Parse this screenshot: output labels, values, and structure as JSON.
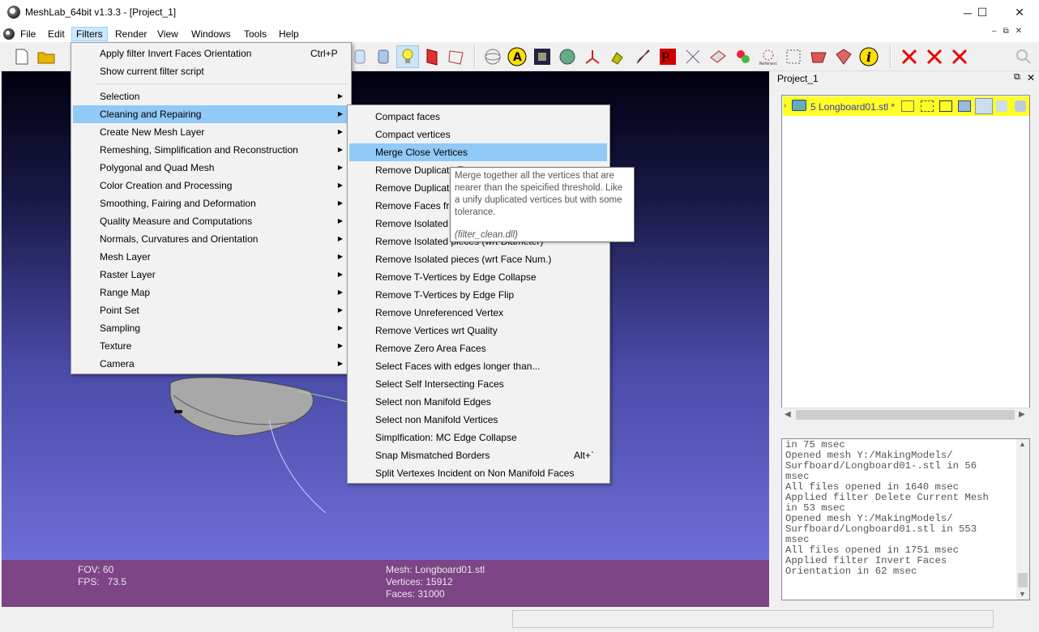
{
  "window": {
    "title": "MeshLab_64bit v1.3.3 - [Project_1]",
    "minimize": "─",
    "maximize": "☐",
    "close": "✕"
  },
  "menubar": {
    "items": [
      "File",
      "Edit",
      "Filters",
      "Render",
      "View",
      "Windows",
      "Tools",
      "Help"
    ],
    "active": "Filters",
    "mdi": [
      "–",
      "⧉",
      "✕"
    ]
  },
  "filters_menu": {
    "apply_label": "Apply filter Invert Faces Orientation",
    "apply_shortcut": "Ctrl+P",
    "show_script": "Show current filter script",
    "items": [
      "Selection",
      "Cleaning and Repairing",
      "Create New Mesh Layer",
      "Remeshing, Simplification and Reconstruction",
      "Polygonal and Quad Mesh",
      "Color Creation and Processing",
      "Smoothing, Fairing and Deformation",
      "Quality Measure and Computations",
      "Normals, Curvatures and Orientation",
      "Mesh Layer",
      "Raster Layer",
      "Range Map",
      "Point Set",
      "Sampling",
      "Texture",
      "Camera"
    ],
    "highlighted": "Cleaning and Repairing"
  },
  "cleaning_submenu": {
    "items": [
      "Compact faces",
      "Compact vertices",
      "Merge Close Vertices",
      "Remove Duplicate F",
      "Remove Duplicate",
      "Remove Faces fro",
      "Remove Isolated",
      "Remove Isolated pieces (wrt Diameter)",
      "Remove Isolated pieces (wrt Face Num.)",
      "Remove T-Vertices by Edge Collapse",
      "Remove T-Vertices by Edge Flip",
      "Remove Unreferenced Vertex",
      "Remove Vertices wrt Quality",
      "Remove Zero Area Faces",
      "Select Faces with edges longer than...",
      "Select Self Intersecting Faces",
      "Select non Manifold Edges",
      "Select non Manifold Vertices",
      "Simplfication: MC Edge Collapse",
      "Snap Mismatched Borders",
      "Split Vertexes Incident on Non Manifold Faces"
    ],
    "highlighted": "Merge Close Vertices",
    "snap_shortcut": "Alt+`"
  },
  "tooltip": {
    "text": "Merge together all the vertices that are nearer than the speicified threshold. Like a unify duplicated vertices but with some tolerance.",
    "plugin": "(filter_clean.dll)"
  },
  "viewport_info": {
    "fov": "FOV: 60",
    "fps": "FPS:   73.5",
    "mesh": "Mesh: Longboard01.stl",
    "vertices": "Vertices: 15912",
    "faces": "Faces: 31000"
  },
  "project_panel": {
    "title": "Project_1",
    "layer": "5  Longboard01.stl *"
  },
  "log": {
    "lines": [
      "in 75 msec",
      "Opened mesh Y:/MakingModels/",
      "Surfboard/Longboard01-.stl in 56",
      "msec",
      "All files opened in 1640 msec",
      "Applied filter Delete Current Mesh",
      "in 53 msec",
      "Opened mesh Y:/MakingModels/",
      "Surfboard/Longboard01.stl in 553",
      "msec",
      "All files opened in 1751 msec",
      "Applied filter Invert Faces",
      "Orientation in 62 msec"
    ]
  },
  "toolbar_icons": [
    "new-file-icon",
    "open-folder-icon",
    "open-icon",
    "shade-icon",
    "smooth-icon",
    "light-bulb-icon",
    "backface-icon",
    "selection-icon",
    "trackball-icon",
    "axis-label-icon",
    "texture-icon",
    "sphere-icon",
    "axes-icon",
    "paint-icon",
    "brush-icon",
    "pp-icon",
    "measure-icon",
    "align-icon",
    "raster-icon",
    "reference-icon",
    "select-vertices-icon",
    "select-faces-icon",
    "select-connected-icon",
    "info-icon",
    "delete-vertices-icon",
    "delete-faces-icon",
    "delete-all-icon",
    "search-icon"
  ]
}
